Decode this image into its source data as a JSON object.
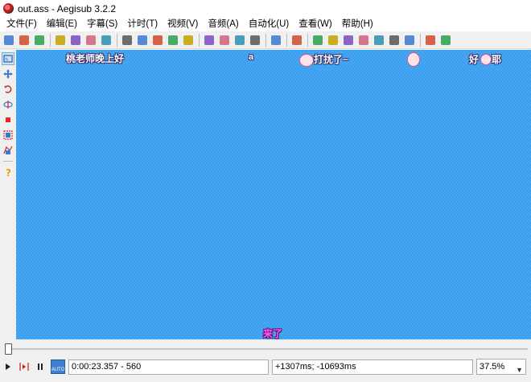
{
  "window": {
    "title": "out.ass - Aegisub 3.2.2"
  },
  "menu": [
    "文件(F)",
    "编辑(E)",
    "字幕(S)",
    "计时(T)",
    "视频(V)",
    "音频(A)",
    "自动化(U)",
    "查看(W)",
    "帮助(H)"
  ],
  "toolbar_icons": [
    "new-file-icon",
    "open-file-icon",
    "save-file-icon",
    "|",
    "jump-to-video-icon",
    "zoom-in-icon",
    "zoom-out-icon",
    "snap-icon",
    "|",
    "open-subtitle-icon",
    "close-subtitle-icon",
    "video-frame-icon",
    "keyframes-icon",
    "video-grid-icon",
    "|",
    "styles-manager-icon",
    "properties-icon",
    "attachments-icon",
    "fonts-collector-icon",
    "|",
    "automation-icon",
    "|",
    "assistant-icon",
    "|",
    "timing-post-processor-icon",
    "kanji-timer-icon",
    "translation-assistant-icon",
    "select-lines-icon",
    "timer-icon",
    "resample-icon",
    "spell-check-icon",
    "|",
    "options-icon",
    "toggle-tags-icon"
  ],
  "video_subtitles": {
    "top_left": "桃老师晚上好",
    "top_center": "a",
    "top_mid_right": "打扰了~",
    "top_right": "好",
    "top_right_tail": "耶",
    "bottom": "来了"
  },
  "status": {
    "time": "0:00:23.357 - 560",
    "offset": "+1307ms; -10693ms",
    "zoom": "37.5%",
    "auto_label": "AUTO"
  },
  "colors": {
    "video_bg": "#3b9ff0",
    "subtitle_bottom": "#ff5ef0"
  }
}
